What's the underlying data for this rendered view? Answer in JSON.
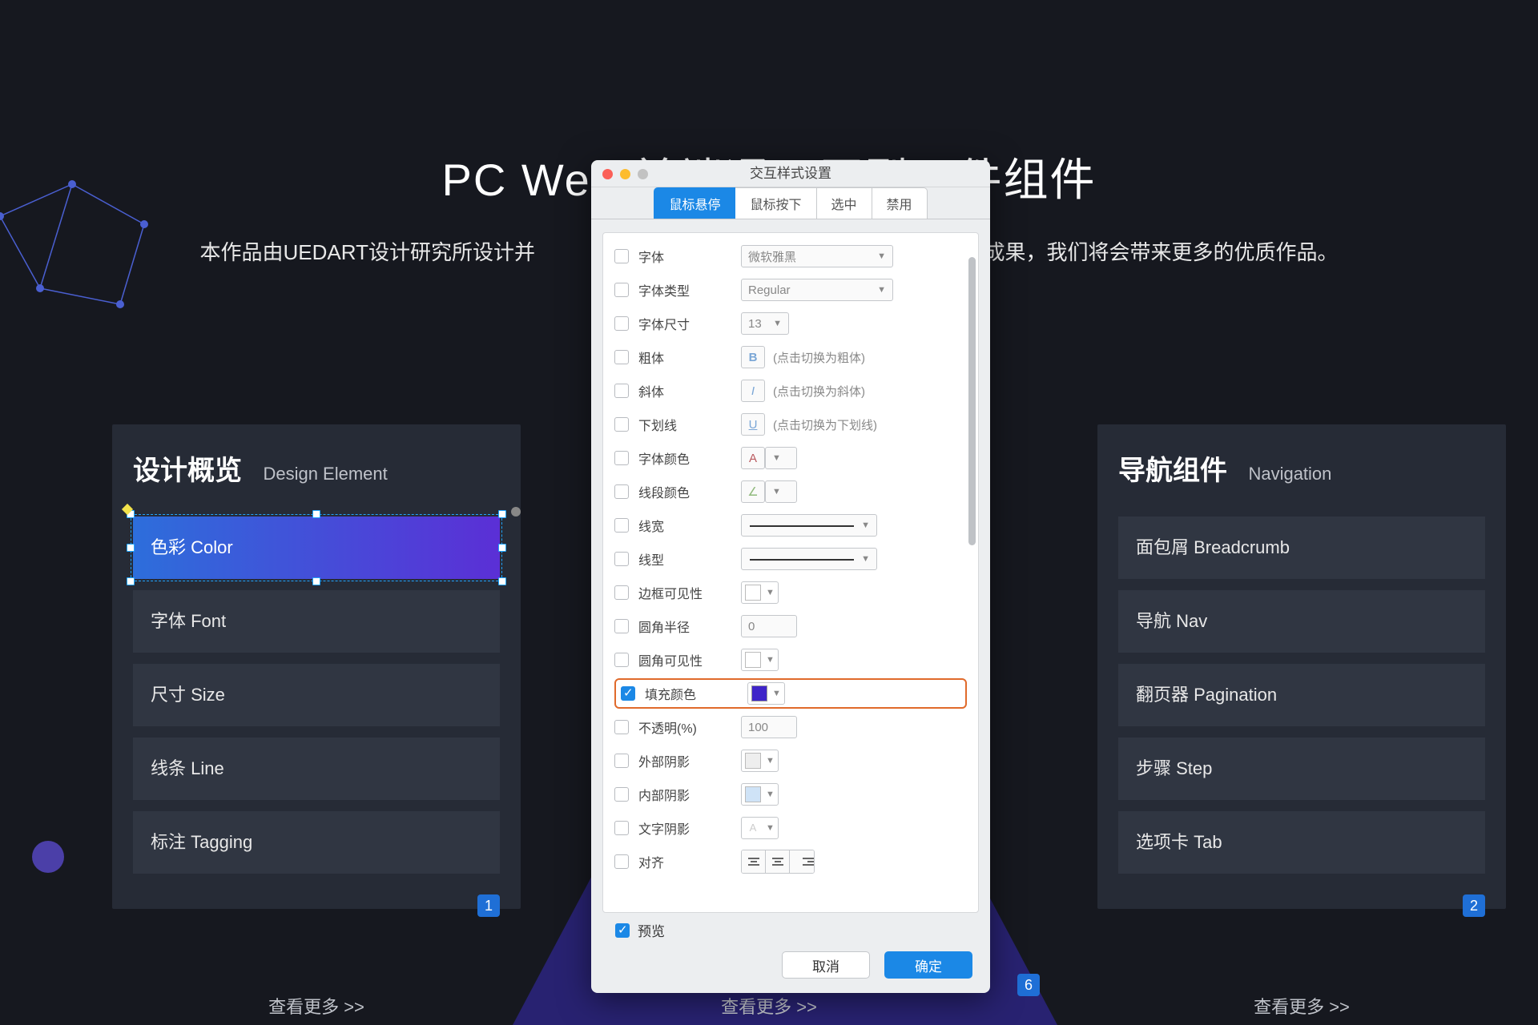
{
  "hero": {
    "title": "PC Web 前端通用原型元件组件",
    "subtitle_prefix": "本作品由UEDART设计研究所设计并",
    "subtitle_suffix": "动成果，我们将会带来更多的优质作品。"
  },
  "card_left": {
    "title": "设计概览",
    "subtitle": "Design Element",
    "items": [
      "色彩 Color",
      "字体 Font",
      "尺寸 Size",
      "线条 Line",
      "标注 Tagging"
    ],
    "active_index": 0,
    "badge": "1",
    "more": "查看更多 >>"
  },
  "card_right": {
    "title": "导航组件",
    "subtitle": "Navigation",
    "items": [
      "面包屑 Breadcrumb",
      "导航 Nav",
      "翻页器 Pagination",
      "步骤 Step",
      "选项卡 Tab"
    ],
    "badge": "2",
    "more": "查看更多 >>"
  },
  "mid": {
    "badge": "6",
    "more": "查看更多 >>"
  },
  "dialog": {
    "title": "交互样式设置",
    "tabs": [
      "鼠标悬停",
      "鼠标按下",
      "选中",
      "禁用"
    ],
    "active_tab": 0,
    "rows": {
      "font": {
        "label": "字体",
        "value": "微软雅黑"
      },
      "font_type": {
        "label": "字体类型",
        "value": "Regular"
      },
      "font_size": {
        "label": "字体尺寸",
        "value": "13"
      },
      "bold": {
        "label": "粗体",
        "hint": "(点击切换为粗体)"
      },
      "italic": {
        "label": "斜体",
        "hint": "(点击切换为斜体)"
      },
      "underline": {
        "label": "下划线",
        "hint": "(点击切换为下划线)"
      },
      "font_color": {
        "label": "字体颜色"
      },
      "line_color": {
        "label": "线段颜色"
      },
      "line_width": {
        "label": "线宽"
      },
      "line_style": {
        "label": "线型"
      },
      "border_vis": {
        "label": "边框可见性"
      },
      "corner_radius": {
        "label": "圆角半径",
        "value": "0"
      },
      "corner_vis": {
        "label": "圆角可见性"
      },
      "fill_color": {
        "label": "填充颜色",
        "checked": true,
        "color": "#3e24c9"
      },
      "opacity": {
        "label": "不透明(%)",
        "value": "100"
      },
      "outer_shadow": {
        "label": "外部阴影"
      },
      "inner_shadow": {
        "label": "内部阴影"
      },
      "text_shadow": {
        "label": "文字阴影"
      },
      "align": {
        "label": "对齐"
      }
    },
    "preview_label": "预览",
    "cancel": "取消",
    "ok": "确定"
  }
}
